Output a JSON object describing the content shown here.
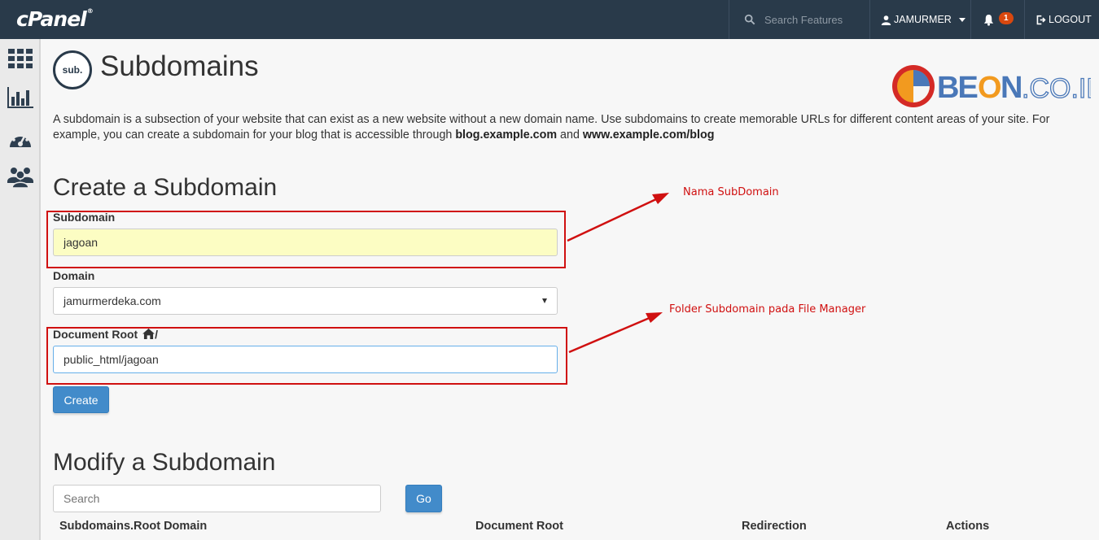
{
  "topbar": {
    "brand": "cPanel",
    "brand_mark": "®",
    "search_placeholder": "Search Features",
    "username": "JAMURMER",
    "notification_count": "1",
    "logout_label": "LOGOUT"
  },
  "sidebar": {
    "items": [
      {
        "icon": "grid-icon"
      },
      {
        "icon": "bar-chart-icon"
      },
      {
        "icon": "dashboard-icon"
      },
      {
        "icon": "users-icon"
      }
    ]
  },
  "header": {
    "badge_text": "sub.",
    "title": "Subdomains",
    "watermark": "BEON.CO.ID"
  },
  "intro": {
    "text_1": "A subdomain is a subsection of your website that can exist as a new website without a new domain name. Use subdomains to create memorable URLs for different content areas of your site. For example, you can create a subdomain for your blog that is accessible through ",
    "example_1": "blog.example.com",
    "text_2": " and ",
    "example_2": "www.example.com/blog"
  },
  "create": {
    "title": "Create a Subdomain",
    "subdomain_label": "Subdomain",
    "subdomain_value": "jagoan",
    "domain_label": "Domain",
    "domain_selected": "jamurmerdeka.com",
    "docroot_label": "Document Root",
    "docroot_suffix": "/",
    "docroot_value": "public_html/jagoan",
    "create_button": "Create"
  },
  "annotations": {
    "subdomain_note": "Nama SubDomain",
    "docroot_note": "Folder Subdomain pada File Manager",
    "color": "#d01010"
  },
  "modify": {
    "title": "Modify a Subdomain",
    "search_placeholder": "Search",
    "go_button": "Go",
    "columns": [
      "Subdomains.Root Domain",
      "Document Root",
      "Redirection",
      "Actions"
    ]
  }
}
